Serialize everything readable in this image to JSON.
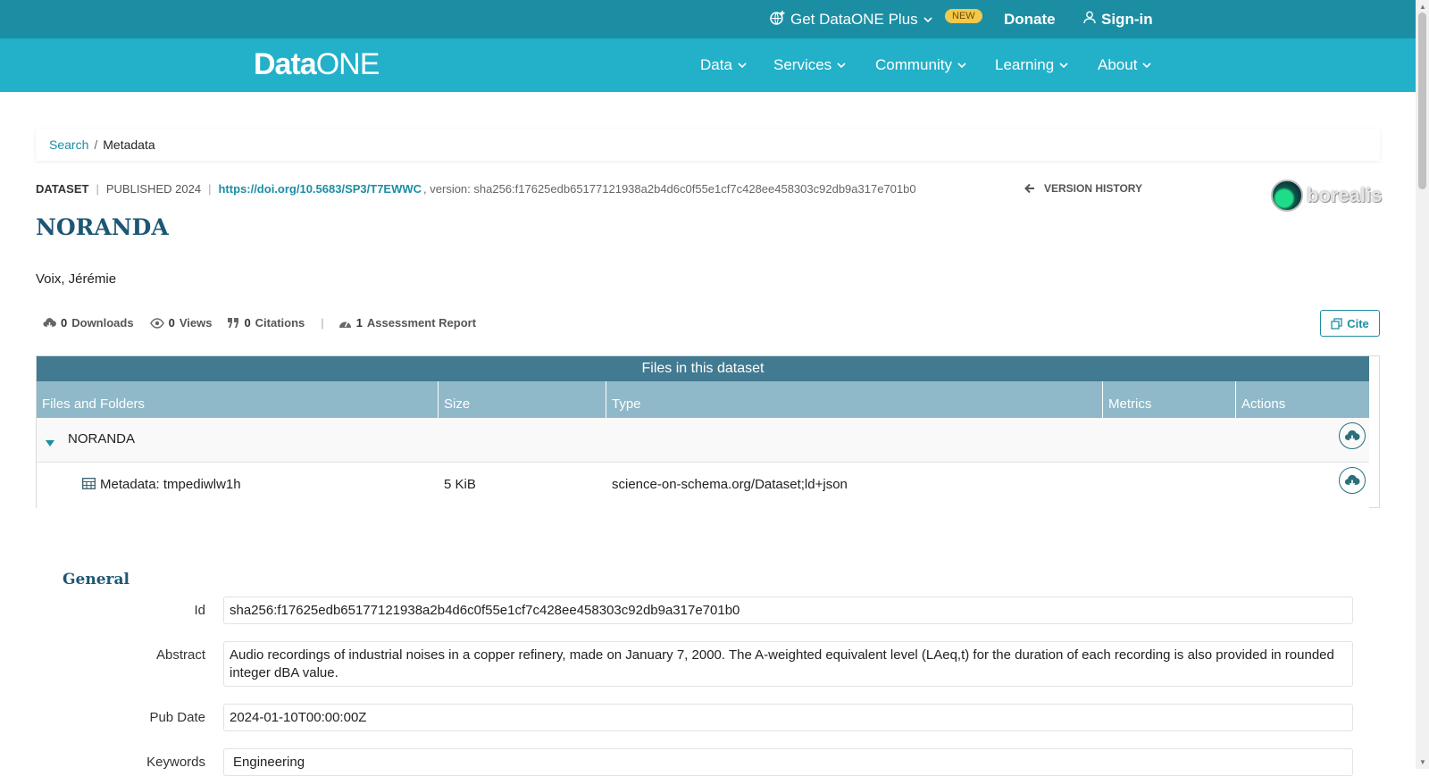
{
  "topbar": {
    "plus_label": "Get DataONE Plus",
    "plus_badge": "NEW",
    "donate": "Donate",
    "signin": "Sign-in"
  },
  "nav": {
    "logo_data": "Data",
    "logo_one": "ONE",
    "items": [
      "Data",
      "Services",
      "Community",
      "Learning",
      "About"
    ]
  },
  "breadcrumb": {
    "search": "Search",
    "separator": "/",
    "current": "Metadata"
  },
  "dataset": {
    "type_label": "DATASET",
    "published": "PUBLISHED 2024",
    "doi": "https://doi.org/10.5683/SP3/T7EWWC",
    "version_text": ", version: sha256:f17625edb65177121938a2b4d6c0f55e1cf7c428ee458303c92db9a317e701b0",
    "version_history": "VERSION HISTORY",
    "repository_logo": "borealis",
    "title": "NORANDA",
    "author": "Voix, Jérémie"
  },
  "stats": {
    "downloads_count": "0",
    "downloads_label": "Downloads",
    "views_count": "0",
    "views_label": "Views",
    "citations_count": "0",
    "citations_label": "Citations",
    "assessment_count": "1",
    "assessment_label": "Assessment Report",
    "cite_label": "Cite"
  },
  "files": {
    "caption": "Files in this dataset",
    "headers": [
      "Files and Folders",
      "Size",
      "Type",
      "Metrics",
      "Actions"
    ],
    "folder": "NORANDA",
    "rows": [
      {
        "name": "Metadata: tmpediwlw1h",
        "size": "5 KiB",
        "type": "science-on-schema.org/Dataset;ld+json"
      }
    ]
  },
  "general": {
    "title": "General",
    "id_label": "Id",
    "id_value": "sha256:f17625edb65177121938a2b4d6c0f55e1cf7c428ee458303c92db9a317e701b0",
    "abstract_label": "Abstract",
    "abstract_value": "Audio recordings of industrial noises in a copper refinery, made on January 7, 2000. The A-weighted equivalent level (LAeq,t) for the duration of each recording is also provided in rounded integer dBA value.",
    "pubdate_label": "Pub Date",
    "pubdate_value": "2024-01-10T00:00:00Z",
    "keywords_label": "Keywords",
    "keywords_value": "Engineering"
  },
  "colors": {
    "topbar": "#1c8ea4",
    "navbar": "#23b0c9",
    "accent": "#1c8ea4",
    "table_caption": "#427a91",
    "table_header": "#8fb8c8",
    "title": "#1d5775"
  }
}
